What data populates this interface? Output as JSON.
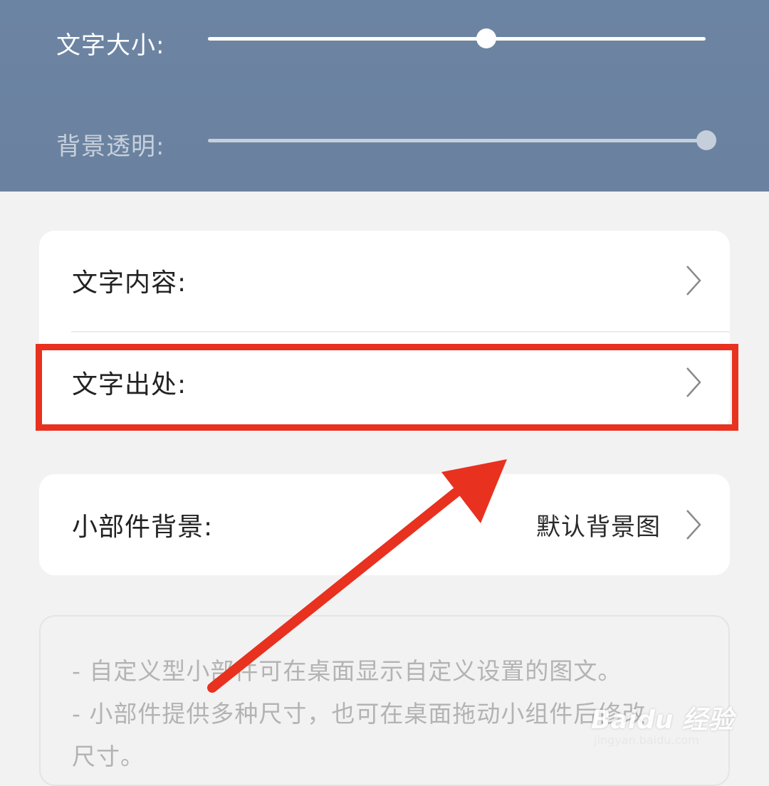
{
  "header": {
    "text_size_label": "文字大小:",
    "text_size_value": 0.56,
    "bg_opacity_label": "背景透明:",
    "bg_opacity_value": 1.0
  },
  "card1": {
    "rows": [
      {
        "label": "文字内容:"
      },
      {
        "label": "文字出处:"
      }
    ]
  },
  "card2": {
    "label": "小部件背景:",
    "value": "默认背景图"
  },
  "info": {
    "lines": [
      "- 自定义型小部件可在桌面显示自定义设置的图文。",
      "- 小部件提供多种尺寸，也可在桌面拖动小组件后修改",
      "尺寸。"
    ]
  },
  "annotation": {
    "highlight_color": "#e8311f",
    "arrow_color": "#e8311f"
  },
  "watermark": {
    "brand": "Baidu 经验",
    "url": "jingyan.baidu.com"
  }
}
